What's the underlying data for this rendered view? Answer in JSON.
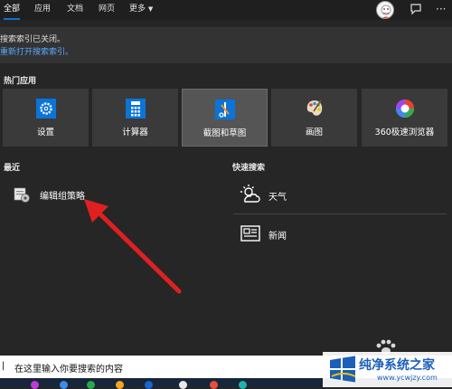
{
  "tabs": [
    {
      "label": "全部"
    },
    {
      "label": "应用"
    },
    {
      "label": "文档"
    },
    {
      "label": "网页"
    },
    {
      "label": "更多"
    }
  ],
  "notice": {
    "line1": "搜索索引已关闭。",
    "line2": "重新打开搜索索引。"
  },
  "top_apps": {
    "title": "热门应用",
    "items": [
      {
        "label": "设置",
        "icon": "gear-icon"
      },
      {
        "label": "计算器",
        "icon": "calculator-icon"
      },
      {
        "label": "截图和草图",
        "icon": "snip-sketch-icon"
      },
      {
        "label": "画图",
        "icon": "paint-palette-icon"
      },
      {
        "label": "360极速浏览器",
        "icon": "browser-360-icon"
      }
    ]
  },
  "recent": {
    "title": "最近",
    "items": [
      {
        "label": "编辑组策略",
        "icon": "group-policy-icon"
      }
    ]
  },
  "quick_search": {
    "title": "快速搜索",
    "items": [
      {
        "label": "天气",
        "icon": "weather-icon"
      },
      {
        "label": "新闻",
        "icon": "news-icon"
      }
    ]
  },
  "search": {
    "text": "在这里输入你要搜索的内容"
  },
  "watermark": {
    "title": "纯净系统之家",
    "url": "www.ycwjzy.com"
  },
  "colors": {
    "accent": "#0a74d8",
    "arrow": "#e02020"
  }
}
